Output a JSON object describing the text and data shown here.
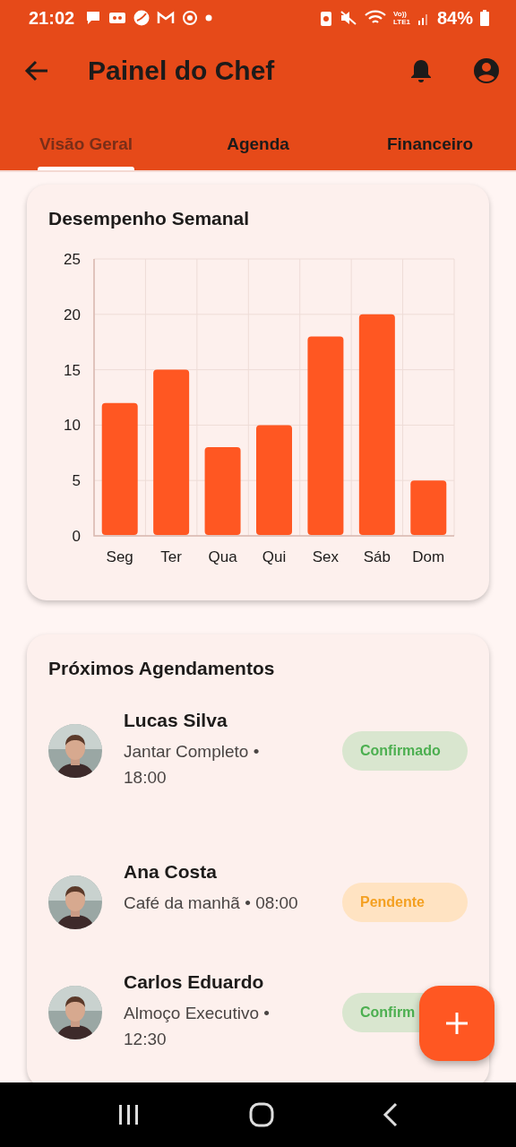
{
  "status_bar": {
    "time": "21:02",
    "network_labels": [
      "Vo))",
      "LTE1"
    ],
    "battery": "84%"
  },
  "app_bar": {
    "title": "Painel do Chef"
  },
  "tabs": [
    {
      "label": "Visão Geral",
      "selected": true
    },
    {
      "label": "Agenda",
      "selected": false
    },
    {
      "label": "Financeiro",
      "selected": false
    }
  ],
  "performance_card": {
    "title": "Desempenho Semanal",
    "chart_data": {
      "type": "bar",
      "categories": [
        "Seg",
        "Ter",
        "Qua",
        "Qui",
        "Sex",
        "Sáb",
        "Dom"
      ],
      "values": [
        12,
        15,
        8,
        10,
        18,
        20,
        5
      ],
      "ylim": [
        0,
        25
      ],
      "yticks": [
        0,
        5,
        10,
        15,
        20,
        25
      ],
      "grid": true
    }
  },
  "appointments_card": {
    "title": "Próximos Agendamentos",
    "items": [
      {
        "name": "Lucas Silva",
        "detail": "Jantar Completo • 18:00",
        "status": "Confirmado",
        "kind": "confirmed"
      },
      {
        "name": "Ana Costa",
        "detail": "Café da manhã • 08:00",
        "status": "Pendente",
        "kind": "pending"
      },
      {
        "name": "Carlos Eduardo",
        "detail": "Almoço Executivo • 12:30",
        "status": "Confirm",
        "kind": "confirmed"
      }
    ]
  }
}
